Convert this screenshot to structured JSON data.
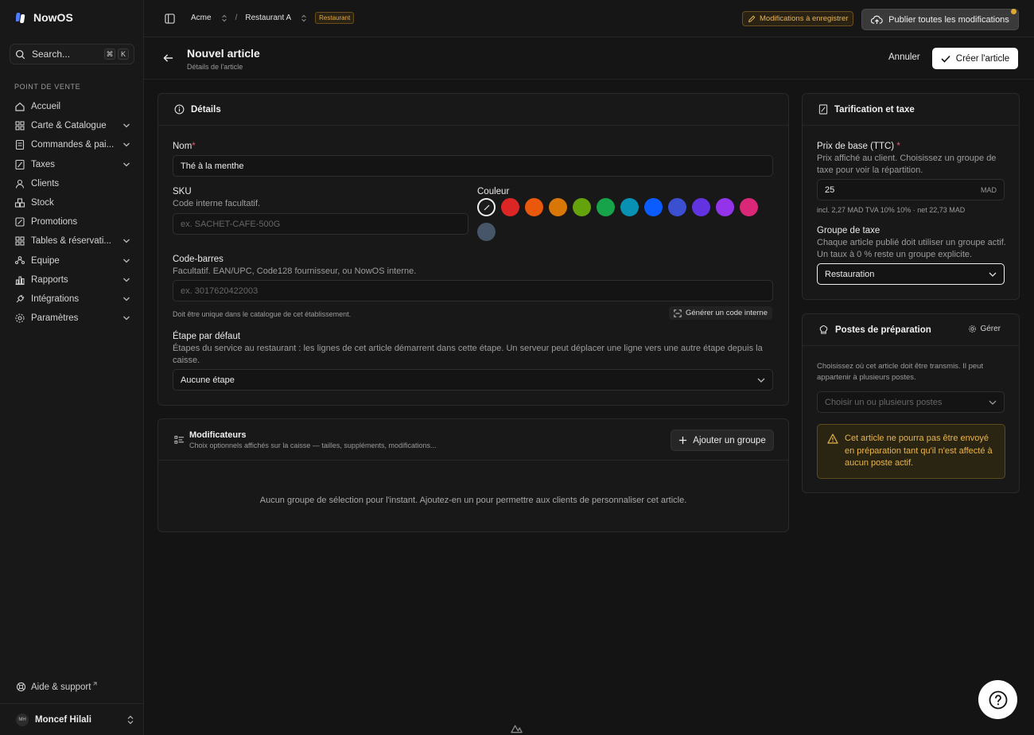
{
  "app": {
    "name": "NowOS"
  },
  "search": {
    "label": "Search...",
    "kbd1": "⌘",
    "kbd2": "K"
  },
  "sidebar": {
    "section": "POINT DE VENTE",
    "items": [
      {
        "label": "Accueil",
        "icon": "home-icon",
        "chevron": false
      },
      {
        "label": "Carte & Catalogue",
        "icon": "grid-icon",
        "chevron": true
      },
      {
        "label": "Commandes & pai...",
        "icon": "receipt-icon",
        "chevron": true
      },
      {
        "label": "Taxes",
        "icon": "percent-icon",
        "chevron": true
      },
      {
        "label": "Clients",
        "icon": "users-icon",
        "chevron": false
      },
      {
        "label": "Stock",
        "icon": "boxes-icon",
        "chevron": false
      },
      {
        "label": "Promotions",
        "icon": "tag-icon",
        "chevron": false
      },
      {
        "label": "Tables & réservati...",
        "icon": "table-icon",
        "chevron": true
      },
      {
        "label": "Équipe",
        "icon": "team-icon",
        "chevron": true
      },
      {
        "label": "Rapports",
        "icon": "bar-chart-icon",
        "chevron": true
      },
      {
        "label": "Intégrations",
        "icon": "plug-icon",
        "chevron": true
      },
      {
        "label": "Paramètres",
        "icon": "gear-icon",
        "chevron": true
      }
    ],
    "help": "Aide & support",
    "user": {
      "initials": "MH",
      "name": "Moncef Hilali"
    }
  },
  "topbar": {
    "org": "Acme",
    "separator": "/",
    "location": "Restaurant A",
    "location_badge": "Restaurant",
    "pending": "Modifications à enregistrer",
    "publish": "Publier toutes les modifications"
  },
  "header": {
    "title": "Nouvel article",
    "subtitle": "Détails de l'article",
    "cancel": "Annuler",
    "create": "Créer l'article"
  },
  "details": {
    "title": "Détails",
    "name_label": "Nom",
    "name_value": "Thé à la menthe",
    "sku_label": "SKU",
    "sku_help": "Code interne facultatif.",
    "sku_placeholder": "ex. SACHET-CAFE-500G",
    "color_label": "Couleur",
    "colors": [
      "none",
      "#dc2626",
      "#ea580c",
      "#d97706",
      "#65a30d",
      "#16a34a",
      "#0891b2",
      "#0a5cff",
      "#3b4fd1",
      "#6233e0",
      "#9333ea",
      "#db2777",
      "#475569"
    ],
    "barcode_label": "Code-barres",
    "barcode_help": "Facultatif. EAN/UPC, Code128 fournisseur, ou NowOS interne.",
    "barcode_placeholder": "ex. 3017620422003",
    "barcode_unique": "Doit être unique dans le catalogue de cet établissement.",
    "generate": "Générer un code interne",
    "stage_label": "Étape par défaut",
    "stage_help": "Étapes du service au restaurant : les lignes de cet article démarrent dans cette étape. Un serveur peut déplacer une ligne vers une autre étape depuis la caisse.",
    "stage_value": "Aucune étape"
  },
  "modifiers": {
    "title": "Modificateurs",
    "subtitle": "Choix optionnels affichés sur la caisse — tailles, suppléments, modifications...",
    "add": "Ajouter un groupe",
    "empty": "Aucun groupe de sélection pour l'instant. Ajoutez-en un pour permettre aux clients de personnaliser cet article."
  },
  "pricing": {
    "title": "Tarification et taxe",
    "price_label": "Prix de base (TTC)",
    "price_help": "Prix affiché au client. Choisissez un groupe de taxe pour voir la répartition.",
    "price_value": "25",
    "currency": "MAD",
    "breakdown": "incl. 2,27 MAD TVA 10% 10% · net 22,73 MAD",
    "tax_label": "Groupe de taxe",
    "tax_help": "Chaque article publié doit utiliser un groupe actif. Un taux à 0 % reste un groupe explicite.",
    "tax_value": "Restauration"
  },
  "stations": {
    "title": "Postes de préparation",
    "manage": "Gérer",
    "help": "Choisissez où cet article doit être transmis. Il peut appartenir à plusieurs postes.",
    "placeholder": "Choisir un ou plusieurs postes",
    "warning": "Cet article ne pourra pas être envoyé en préparation tant qu'il n'est affecté à aucun poste actif."
  }
}
